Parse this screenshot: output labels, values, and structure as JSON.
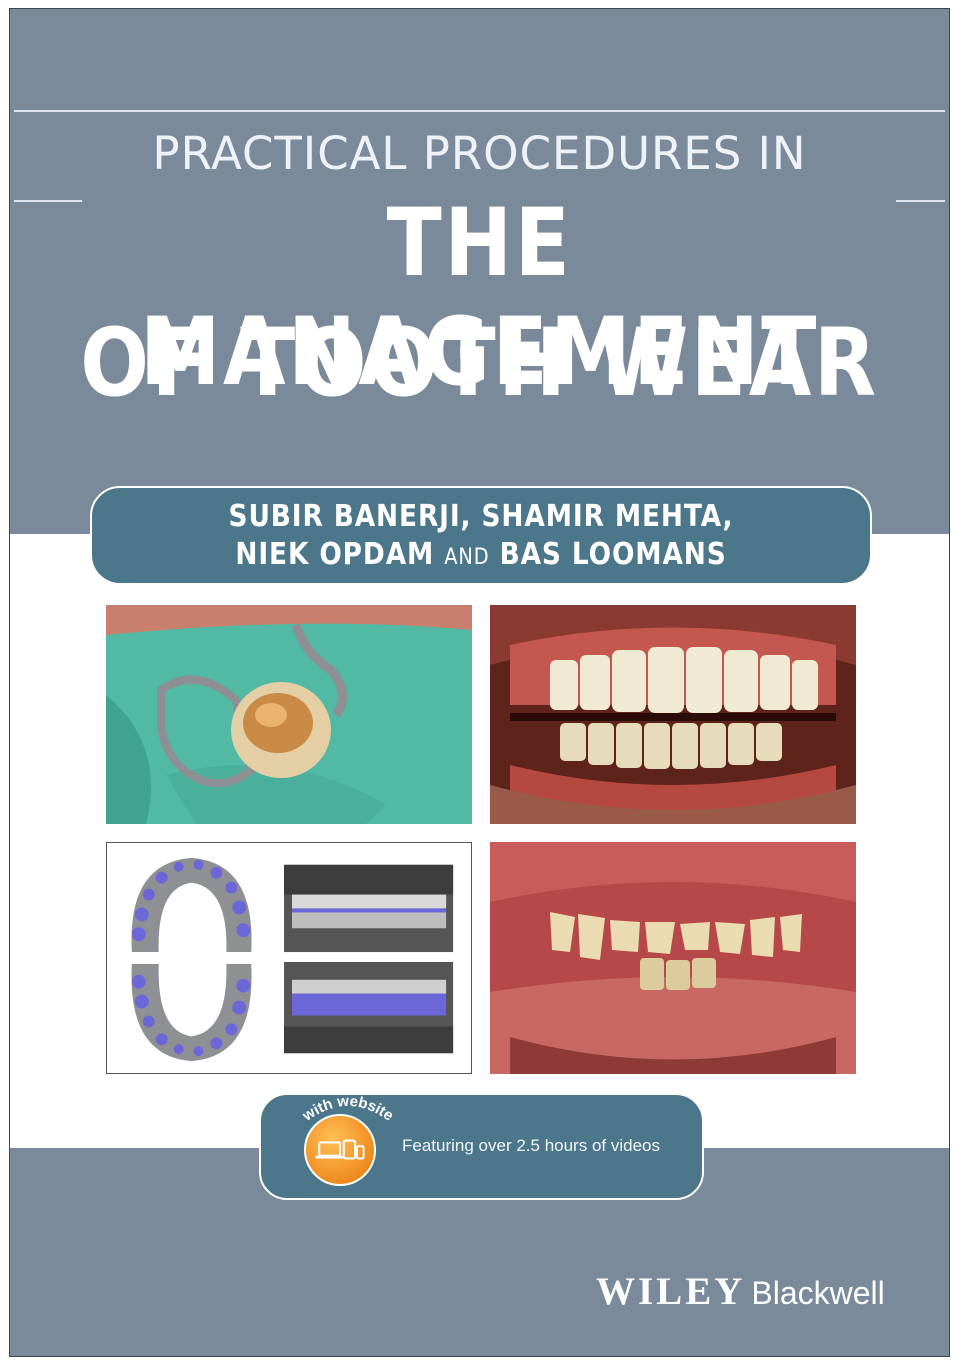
{
  "cover": {
    "title_line1": "PRACTICAL PROCEDURES IN",
    "title_line2": "THE MANAGEMENT",
    "title_line3": "OF TOOTH WEAR",
    "authors_line1": "SUBIR BANERJI, SHAMIR MEHTA,",
    "authors_line2_a": "NIEK OPDAM",
    "authors_and": "AND",
    "authors_line2_b": "BAS LOOMANS",
    "website_badge": "with website",
    "website_text": "Featuring over 2.5 hours of videos",
    "publisher_wiley": "WILEY",
    "publisher_blackwell": "Blackwell",
    "colors": {
      "background": "#7b8a9b",
      "pill": "#4c7689",
      "badge": "#ef8b20"
    },
    "icons": [
      "laptop-icon",
      "tablet-icon",
      "phone-icon"
    ]
  }
}
